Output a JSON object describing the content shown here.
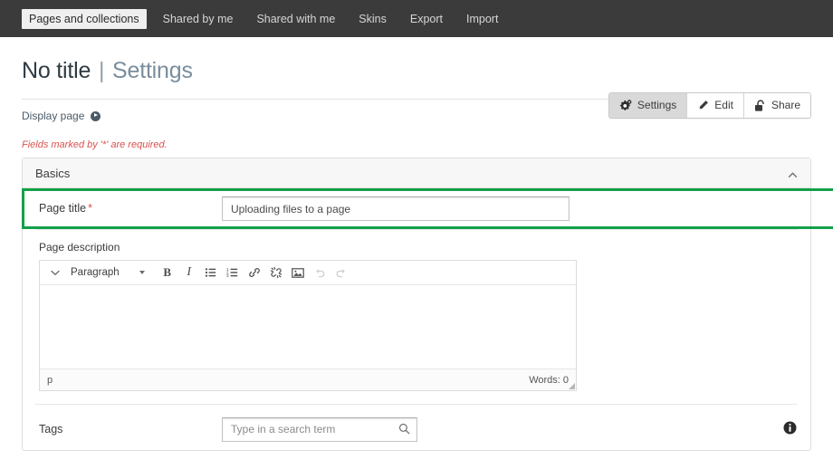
{
  "topnav": {
    "tabs": [
      {
        "label": "Pages and collections",
        "active": true
      },
      {
        "label": "Shared by me",
        "active": false
      },
      {
        "label": "Shared with me",
        "active": false
      },
      {
        "label": "Skins",
        "active": false
      },
      {
        "label": "Export",
        "active": false
      },
      {
        "label": "Import",
        "active": false
      }
    ]
  },
  "header": {
    "title_main": "No title",
    "title_separator": "|",
    "title_sub": "Settings",
    "display_page_label": "Display page",
    "buttons": [
      {
        "label": "Settings",
        "icon": "gears-icon",
        "active": true
      },
      {
        "label": "Edit",
        "icon": "pencil-icon",
        "active": false
      },
      {
        "label": "Share",
        "icon": "unlock-icon",
        "active": false
      }
    ]
  },
  "form": {
    "required_note": "Fields marked by '*' are required.",
    "panel_title": "Basics",
    "page_title": {
      "label": "Page title",
      "required_marker": "*",
      "value": "Uploading files to a page",
      "highlight_color": "#14a04a"
    },
    "page_description": {
      "label": "Page description",
      "body_text": "",
      "toolbar": [
        {
          "name": "toggle-toolbar",
          "icon": "chevron-down-icon"
        },
        {
          "name": "format-select",
          "label": "Paragraph",
          "icon": "caret-down-icon"
        },
        {
          "name": "bold",
          "label": "B",
          "icon": "bold-icon"
        },
        {
          "name": "italic",
          "label": "I",
          "icon": "italic-icon"
        },
        {
          "name": "bullet-list",
          "icon": "bullet-list-icon"
        },
        {
          "name": "numbered-list",
          "icon": "numbered-list-icon"
        },
        {
          "name": "insert-link",
          "icon": "link-icon"
        },
        {
          "name": "remove-link",
          "icon": "unlink-icon"
        },
        {
          "name": "insert-image",
          "icon": "image-icon"
        },
        {
          "name": "undo",
          "icon": "undo-icon",
          "disabled": true
        },
        {
          "name": "redo",
          "icon": "redo-icon",
          "disabled": true
        }
      ],
      "status_path": "p",
      "word_count": "Words: 0"
    },
    "tags": {
      "label": "Tags",
      "placeholder": "Type in a search term",
      "value": ""
    }
  }
}
